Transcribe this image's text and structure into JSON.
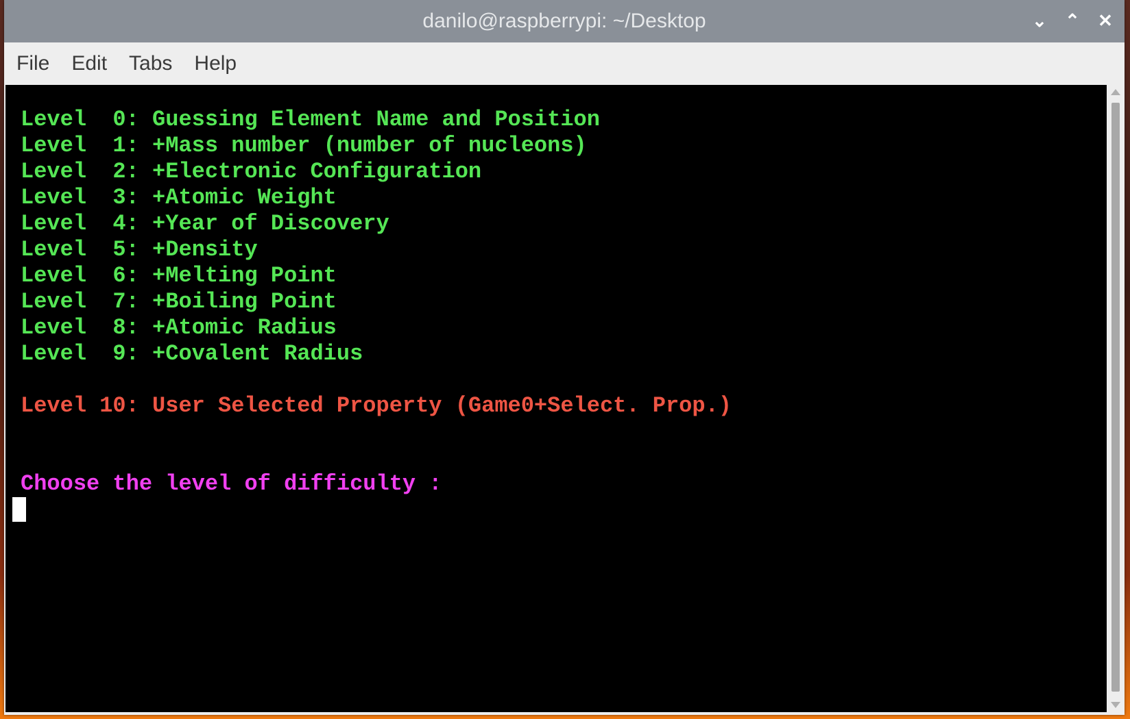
{
  "window": {
    "title": "danilo@raspberrypi: ~/Desktop",
    "controls": {
      "minimize": "⌄",
      "maximize": "⌃",
      "close": "✕"
    }
  },
  "menu": {
    "items": [
      "File",
      "Edit",
      "Tabs",
      "Help"
    ]
  },
  "terminal": {
    "levels": [
      "Level  0: Guessing Element Name and Position",
      "Level  1: +Mass number (number of nucleons)",
      "Level  2: +Electronic Configuration",
      "Level  3: +Atomic Weight",
      "Level  4: +Year of Discovery",
      "Level  5: +Density",
      "Level  6: +Melting Point",
      "Level  7: +Boiling Point",
      "Level  8: +Atomic Radius",
      "Level  9: +Covalent Radius"
    ],
    "special_level": "Level 10: User Selected Property (Game0+Select. Prop.)",
    "prompt": "Choose the level of difficulty :",
    "colors": {
      "levels": "#55e655",
      "special": "#ee5544",
      "prompt": "#f040f0",
      "background": "#000000"
    }
  }
}
